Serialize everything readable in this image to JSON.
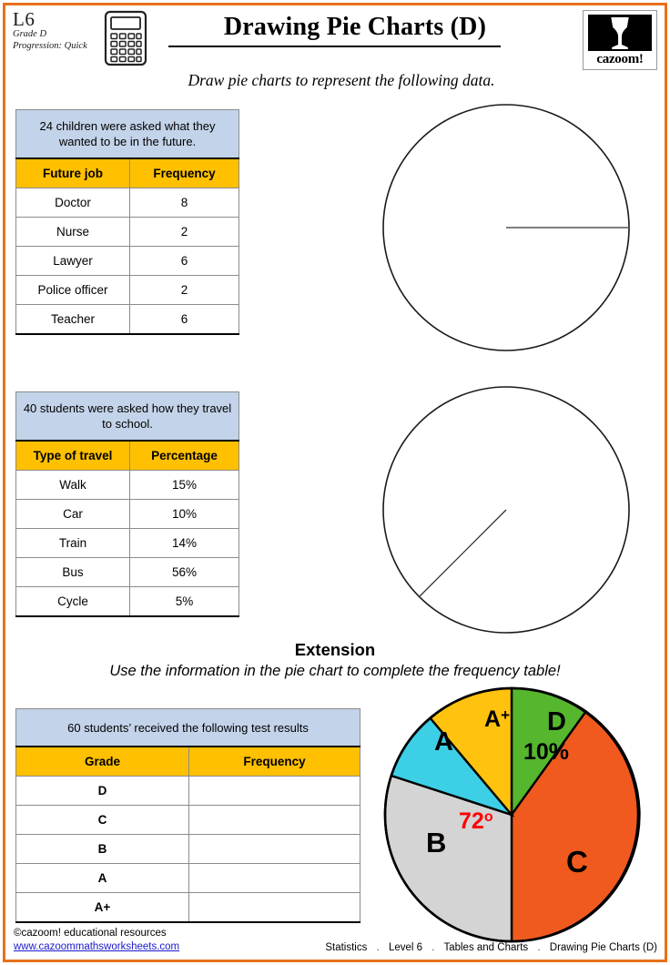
{
  "header": {
    "level_code": "L6",
    "grade": "Grade D",
    "progression": "Progression: Quick",
    "title": "Drawing Pie Charts (D)",
    "instruction": "Draw pie charts to represent the following data.",
    "logo_word": "cazoom!",
    "calculator_icon": "calculator-icon"
  },
  "table1": {
    "caption": "24 children were asked what they wanted to be in the future.",
    "columns": [
      "Future job",
      "Frequency"
    ],
    "rows": [
      [
        "Doctor",
        "8"
      ],
      [
        "Nurse",
        "2"
      ],
      [
        "Lawyer",
        "6"
      ],
      [
        "Police officer",
        "2"
      ],
      [
        "Teacher",
        "6"
      ]
    ]
  },
  "table2": {
    "caption": "40 students were asked how they travel to school.",
    "columns": [
      "Type of travel",
      "Percentage"
    ],
    "rows": [
      [
        "Walk",
        "15%"
      ],
      [
        "Car",
        "10%"
      ],
      [
        "Train",
        "14%"
      ],
      [
        "Bus",
        "56%"
      ],
      [
        "Cycle",
        "5%"
      ]
    ]
  },
  "table3": {
    "caption": "60 students’ received the following test results",
    "columns": [
      "Grade",
      "Frequency"
    ],
    "rows": [
      [
        "D",
        ""
      ],
      [
        "C",
        ""
      ],
      [
        "B",
        ""
      ],
      [
        "A",
        ""
      ],
      [
        "A+",
        ""
      ]
    ]
  },
  "extension": {
    "title": "Extension",
    "subtitle": "Use the information in the pie chart to complete the frequency table!"
  },
  "footer": {
    "copyright": "©cazoom! educational resources",
    "url": "www.cazoommathsworksheets.com",
    "breadcrumb": [
      "Statistics",
      "Level 6",
      "Tables and Charts",
      "Drawing Pie Charts (D)"
    ],
    "separator": "."
  },
  "chart_data": [
    {
      "type": "pie",
      "name": "blank-pie-chart-1",
      "title": "",
      "labels": [],
      "values": [],
      "start_angle_deg": 0,
      "radius_line_angle_deg": 0,
      "note": "empty circle with single horizontal radius drawn to the right"
    },
    {
      "type": "pie",
      "name": "blank-pie-chart-2",
      "title": "",
      "labels": [],
      "values": [],
      "radius_line_angle_deg": 225,
      "note": "empty circle with single radius drawn toward lower-left"
    },
    {
      "type": "pie",
      "name": "extension-pie-chart",
      "title": "",
      "labels": [
        "D",
        "C",
        "B",
        "A",
        "A+"
      ],
      "values": [
        10,
        40,
        20,
        19,
        11
      ],
      "angles_deg": [
        36,
        144,
        72,
        68,
        40
      ],
      "colors": [
        "#56B62E",
        "#F05A1E",
        "#D4D4D4",
        "#3DCFE6",
        "#FFC20E"
      ],
      "annotations": [
        {
          "text": "10%",
          "slice": "D",
          "color": "#000000"
        },
        {
          "text": "72°",
          "slice": "B",
          "color": "#FF0000"
        }
      ],
      "legend": "none",
      "start_angle_deg": 0
    }
  ]
}
